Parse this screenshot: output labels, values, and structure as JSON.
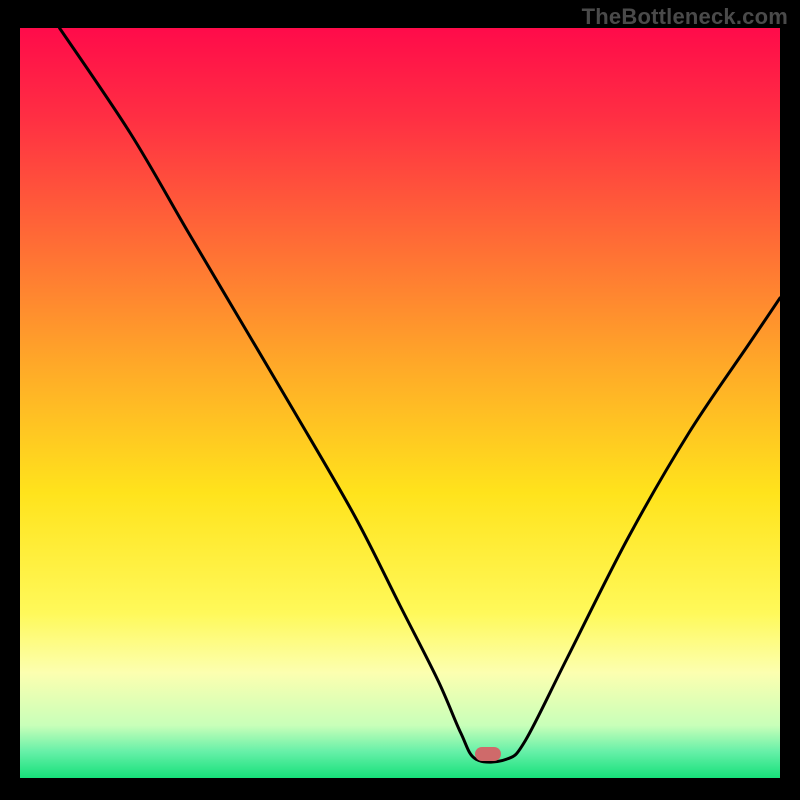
{
  "watermark": "TheBottleneck.com",
  "gradient": {
    "stops": [
      {
        "offset": 0.0,
        "color": "#ff0b4a"
      },
      {
        "offset": 0.12,
        "color": "#ff2f43"
      },
      {
        "offset": 0.28,
        "color": "#ff6a36"
      },
      {
        "offset": 0.45,
        "color": "#ffa928"
      },
      {
        "offset": 0.62,
        "color": "#ffe31c"
      },
      {
        "offset": 0.78,
        "color": "#fff95a"
      },
      {
        "offset": 0.86,
        "color": "#fcffb0"
      },
      {
        "offset": 0.93,
        "color": "#c8ffb9"
      },
      {
        "offset": 0.965,
        "color": "#66f0a8"
      },
      {
        "offset": 1.0,
        "color": "#16e07a"
      }
    ]
  },
  "marker": {
    "x_pct": 61.6,
    "y_pct": 96.8
  },
  "chart_data": {
    "type": "line",
    "title": "",
    "xlabel": "",
    "ylabel": "",
    "xlim": [
      0,
      100
    ],
    "ylim": [
      0,
      100
    ],
    "series": [
      {
        "name": "bottleneck-curve",
        "x": [
          5.2,
          14.5,
          22.0,
          29.0,
          36.0,
          44.0,
          50.0,
          55.0,
          58.0,
          60.0,
          64.0,
          66.5,
          72.0,
          80.0,
          88.0,
          96.0,
          100.0
        ],
        "y": [
          100.0,
          86.0,
          73.0,
          61.0,
          49.0,
          35.0,
          23.0,
          13.0,
          6.0,
          2.5,
          2.5,
          5.0,
          16.0,
          32.0,
          46.0,
          58.0,
          64.0
        ]
      }
    ],
    "annotations": [
      {
        "type": "marker",
        "x": 62,
        "y": 2.5,
        "label": "optimal-point"
      }
    ]
  }
}
